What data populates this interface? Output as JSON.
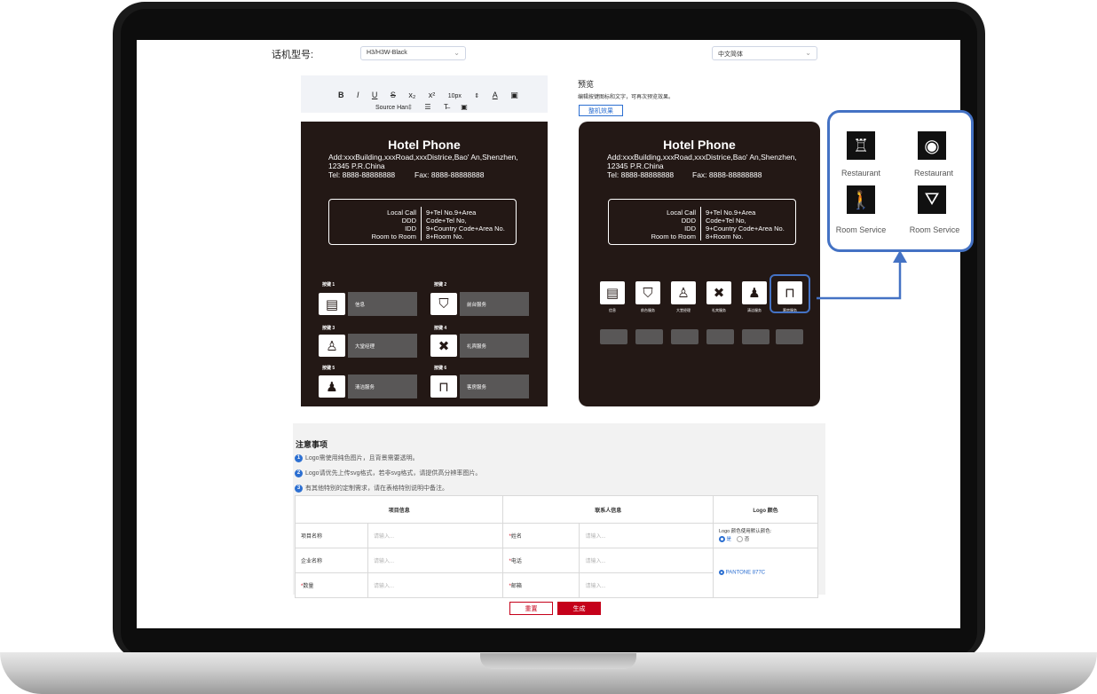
{
  "header": {
    "model_label": "话机型号:",
    "model_value": "H3/H3W-Black",
    "language_value": "中文简体"
  },
  "editor": {
    "toolbar_row1": [
      "B",
      "I",
      "U",
      "S",
      "x₂",
      "x²",
      "10px",
      "⇕",
      "A",
      "▣"
    ],
    "toolbar_row2": [
      "Source Han‡",
      "☰",
      "T̶",
      "▣"
    ]
  },
  "preview": {
    "title": "预览",
    "hint": "编辑按键图标和文字，可再次预览效果。",
    "button": "整机效果"
  },
  "card": {
    "title": "Hotel Phone",
    "address": "Add:xxxBuilding,xxxRoad,xxxDistrice,Bao' An,Shenzhen,",
    "postcode": "12345 P.R.China",
    "tel": "Tel:  8888-88888888",
    "fax": "Fax:  8888-88888888",
    "dial_left": [
      "Local Call",
      "DDD",
      "IDD",
      "Room to Room"
    ],
    "dial_right": [
      "9+Tel No.9+Area",
      "Code+Tel No,",
      "9+Country Code+Area No.",
      "8+Room No."
    ],
    "keys": [
      {
        "label": "按键 1",
        "name": "信息",
        "icon": "document-icon",
        "glyph": "▤"
      },
      {
        "label": "按键 2",
        "name": "前台服务",
        "icon": "reception-icon",
        "glyph": "⛉"
      },
      {
        "label": "按键 3",
        "name": "大堂经理",
        "icon": "manager-icon",
        "glyph": "♙"
      },
      {
        "label": "按键 4",
        "name": "礼宾服务",
        "icon": "tools-icon",
        "glyph": "✖"
      },
      {
        "label": "按键 5",
        "name": "清洁服务",
        "icon": "cleaning-icon",
        "glyph": "♟"
      },
      {
        "label": "按键 6",
        "name": "客房服务",
        "icon": "room-icon",
        "glyph": "⊓"
      }
    ]
  },
  "preview_keys": [
    {
      "name": "信息",
      "glyph": "▤",
      "icon": "document-icon"
    },
    {
      "name": "前台服务",
      "glyph": "⛉",
      "icon": "reception-icon"
    },
    {
      "name": "大堂经理",
      "glyph": "♙",
      "icon": "manager-icon"
    },
    {
      "name": "礼宾服务",
      "glyph": "✖",
      "icon": "tools-icon"
    },
    {
      "name": "清洁服务",
      "glyph": "♟",
      "icon": "cleaning-icon"
    },
    {
      "name": "客房服务",
      "glyph": "⊓",
      "icon": "room-icon"
    }
  ],
  "callout": {
    "items": [
      {
        "label": "Restaurant",
        "icon": "restaurant-table-icon",
        "glyph": "♖"
      },
      {
        "label": "Restaurant",
        "icon": "restaurant-plate-icon",
        "glyph": "◉"
      },
      {
        "label": "Room Service",
        "icon": "room-service-waiter-icon",
        "glyph": "🚶"
      },
      {
        "label": "Room Service",
        "icon": "room-service-cloche-icon",
        "glyph": "⛛"
      }
    ]
  },
  "notes": {
    "title": "注意事项",
    "items": [
      "Logo需使用纯色图片，且背景需要透明。",
      "Logo请优先上传svg格式，若非svg格式，请提供高分辨率图片。",
      "有其他特别的定制需求，请在表格特别说明中备注。"
    ]
  },
  "form": {
    "headers": [
      "项目信息",
      "联系人信息",
      "Logo 颜色"
    ],
    "rows": [
      {
        "left_label": "项目名称",
        "left_req": "",
        "right_label": "姓名",
        "right_req": "*"
      },
      {
        "left_label": "企业名称",
        "left_req": "",
        "right_label": "电话",
        "right_req": "*"
      },
      {
        "left_label": "数量",
        "left_req": "*",
        "right_label": "邮箱",
        "right_req": "*"
      }
    ],
    "placeholder": "请输入...",
    "logo_color_question": "Logo 颜色使用默认颜色:",
    "yes": "是",
    "no": "否",
    "pantone": "PANTONE 877C"
  },
  "actions": {
    "reset": "重置",
    "generate": "生成"
  },
  "colors": {
    "accent_blue": "#4472c4",
    "brand_red": "#c5001a",
    "card_bg": "#231815"
  }
}
